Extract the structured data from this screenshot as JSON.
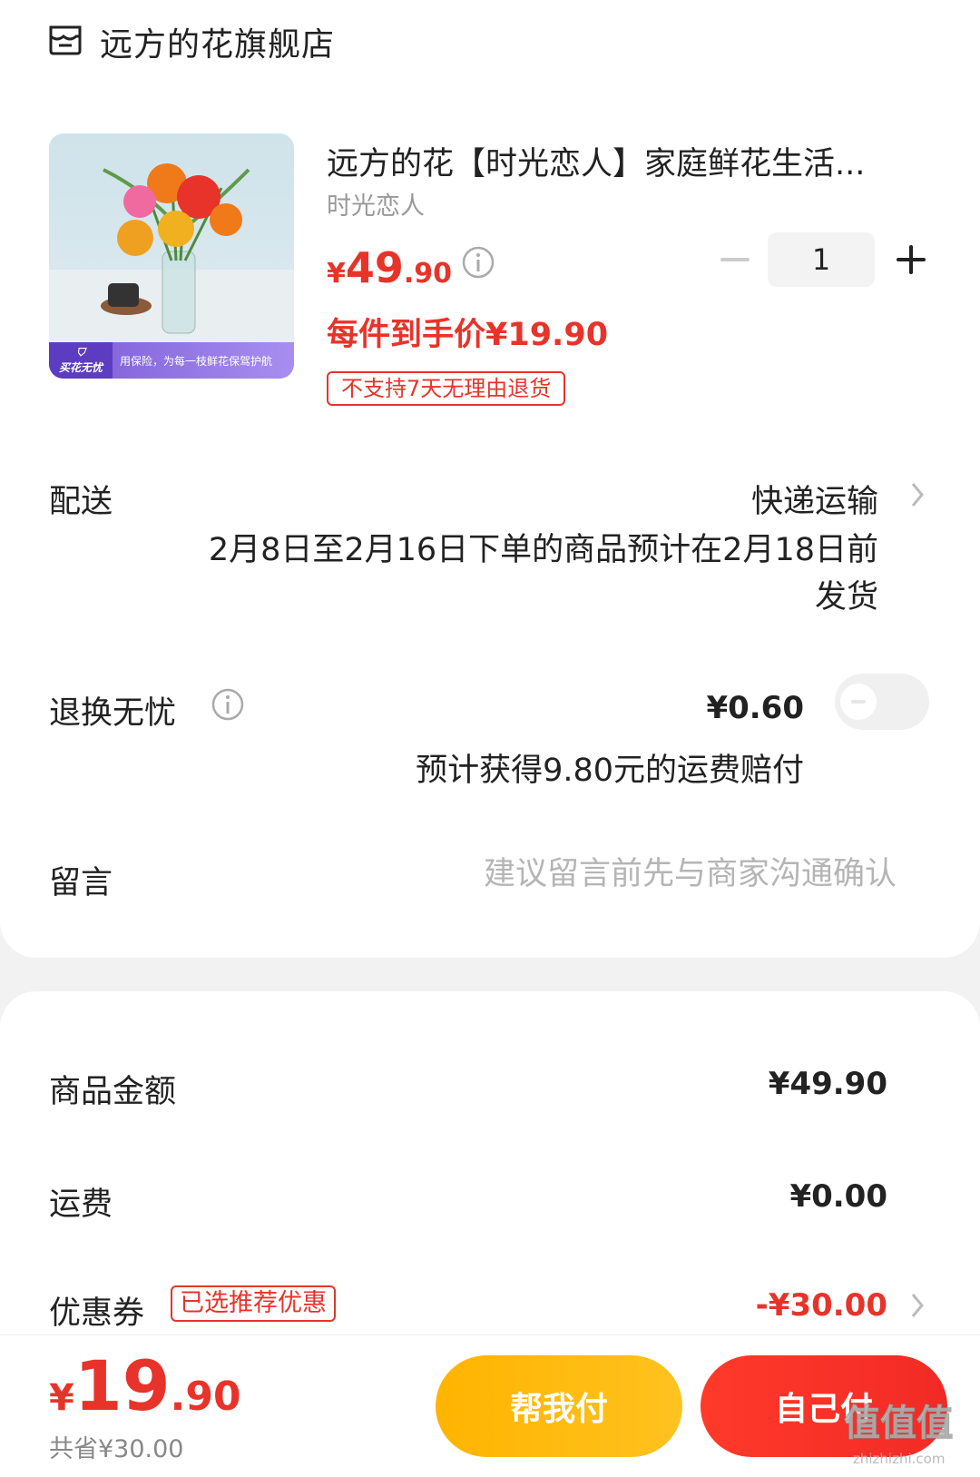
{
  "store": {
    "name": "远方的花旗舰店",
    "icon": "store-icon"
  },
  "product": {
    "title": "远方的花【时光恋人】家庭鲜花生活...",
    "variant": "时光恋人",
    "price_symbol": "¥",
    "price_int": "49",
    "price_dec": ".90",
    "unit_price": "每件到手价¥19.90",
    "no_return": "不支持7天无理由退货",
    "quantity": "1",
    "image_badge": "买花无忧",
    "image_banner": "用保险，为每一枝鲜花保驾护航"
  },
  "delivery": {
    "label": "配送",
    "method": "快递运输",
    "note": "2月8日至2月16日下单的商品预计在2月18日前发货"
  },
  "return_service": {
    "label": "退换无忧",
    "price": "¥0.60",
    "note": "预计获得9.80元的运费赔付",
    "enabled": false
  },
  "message": {
    "label": "留言",
    "placeholder": "建议留言前先与商家沟通确认",
    "value": ""
  },
  "summary": {
    "goods_label": "商品金额",
    "goods_value": "¥49.90",
    "shipping_label": "运费",
    "shipping_value": "¥0.00",
    "coupon_label": "优惠券",
    "coupon_badge": "已选推荐优惠",
    "coupon_value": "-¥30.00"
  },
  "footer": {
    "total_symbol": "¥",
    "total_int": "19",
    "total_dec": ".90",
    "saved": "共省¥30.00",
    "help_pay": "帮我付",
    "self_pay": "自己付"
  },
  "watermark": {
    "text": "值值值",
    "sub": "zhizhizhi.com"
  },
  "colors": {
    "accent": "#e8332a",
    "help_btn": "#ffb400",
    "self_btn": "#f22a26"
  }
}
